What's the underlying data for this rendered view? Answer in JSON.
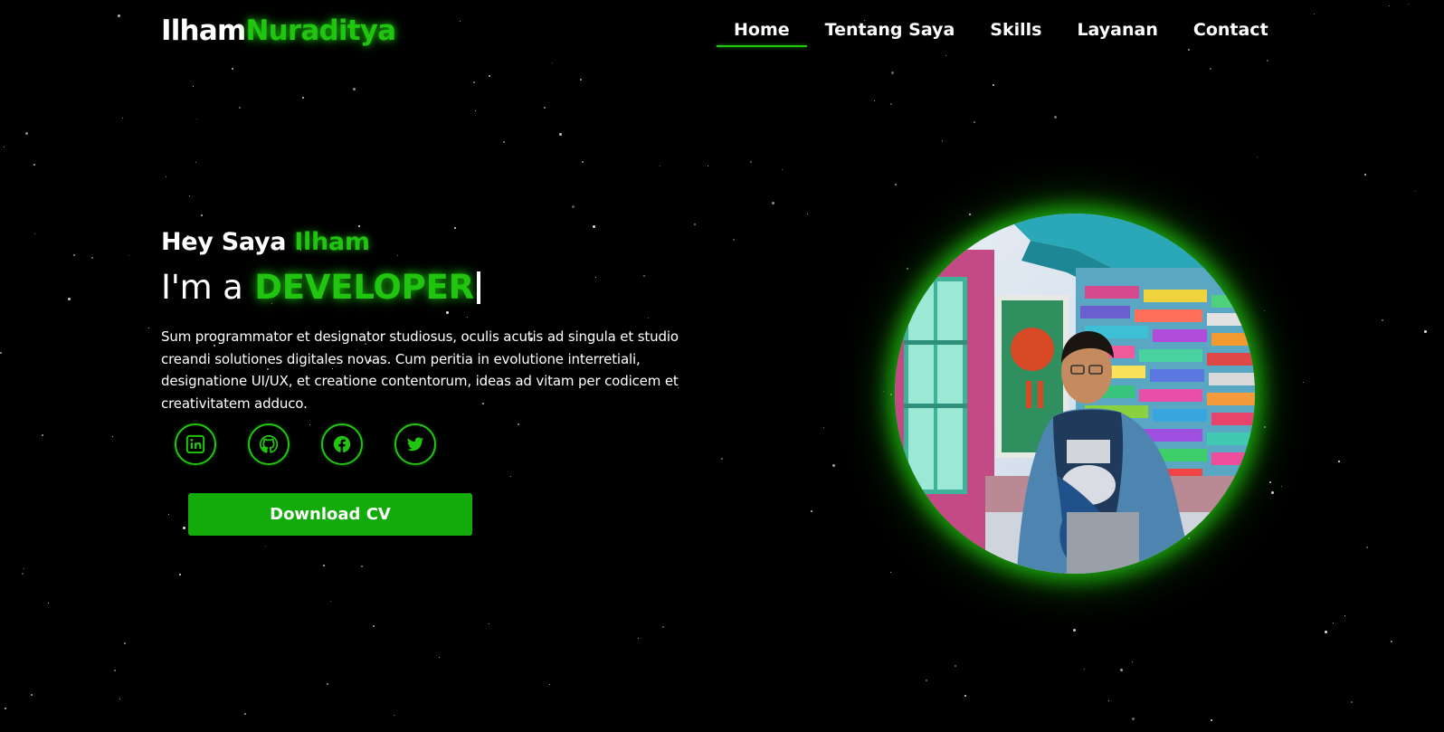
{
  "header": {
    "logo_first": "Ilham",
    "logo_second": "Nuraditya",
    "nav": [
      {
        "label": "Home",
        "active": true
      },
      {
        "label": "Tentang Saya",
        "active": false
      },
      {
        "label": "Skills",
        "active": false
      },
      {
        "label": "Layanan",
        "active": false
      },
      {
        "label": "Contact",
        "active": false
      }
    ]
  },
  "hero": {
    "greeting_prefix": "Hey Saya",
    "greeting_name": "Ilham",
    "role_prefix": "I'm a",
    "role_word": "DEVELOPER",
    "description": "Sum programmator et designator studiosus, oculis acutis ad singula et studio creandi solutiones digitales novas. Cum peritia in evolutione interretiali, designatione UI/UX, et creatione contentorum, ideas ad vitam per codicem et creativitatem adduco.",
    "socials": [
      {
        "icon": "linkedin-icon"
      },
      {
        "icon": "github-icon"
      },
      {
        "icon": "facebook-icon"
      },
      {
        "icon": "twitter-icon"
      }
    ],
    "download_label": "Download CV"
  },
  "colors": {
    "accent": "#21c40f",
    "button": "#12ab0a",
    "background": "#000000",
    "text": "#ffffff"
  }
}
